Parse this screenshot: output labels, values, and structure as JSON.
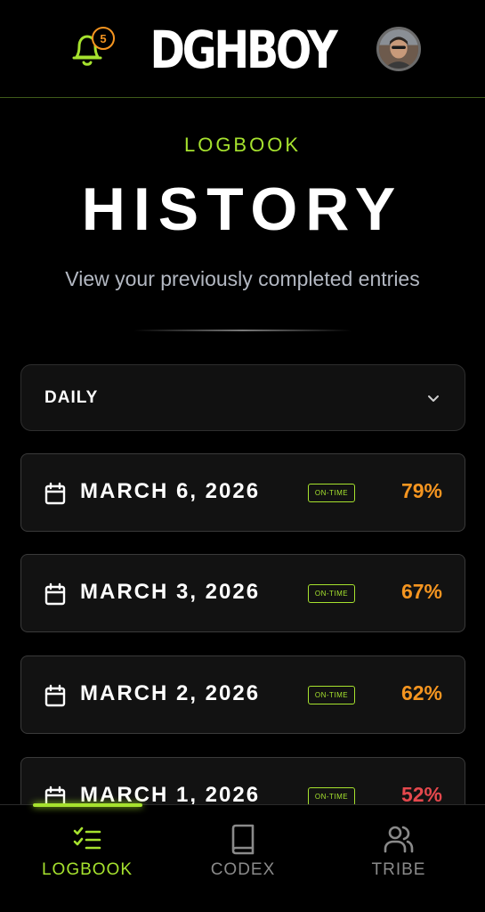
{
  "header": {
    "logo": "DGHBOY",
    "notification_count": "5",
    "icons": [
      "bell-icon",
      "avatar"
    ]
  },
  "page": {
    "eyebrow": "LOGBOOK",
    "title": "HISTORY",
    "subtitle": "View your previously completed entries"
  },
  "filter": {
    "selected": "DAILY",
    "icon": "chevron-down-icon"
  },
  "entries": [
    {
      "date": "MARCH 6, 2026",
      "status": "ON-TIME",
      "percent": "79%",
      "percent_color": "#f59520"
    },
    {
      "date": "MARCH 3, 2026",
      "status": "ON-TIME",
      "percent": "67%",
      "percent_color": "#f59520"
    },
    {
      "date": "MARCH 2, 2026",
      "status": "ON-TIME",
      "percent": "62%",
      "percent_color": "#f59520"
    },
    {
      "date": "MARCH 1, 2026",
      "status": "ON-TIME",
      "percent": "52%",
      "percent_color": "#e5484d"
    }
  ],
  "nav": {
    "items": [
      {
        "label": "LOGBOOK",
        "icon": "checklist-icon",
        "active": true
      },
      {
        "label": "CODEX",
        "icon": "book-icon",
        "active": false
      },
      {
        "label": "TRIBE",
        "icon": "users-icon",
        "active": false
      }
    ]
  },
  "colors": {
    "accent": "#a6e22e",
    "warning": "#f59520",
    "danger": "#e5484d",
    "background": "#000000"
  }
}
